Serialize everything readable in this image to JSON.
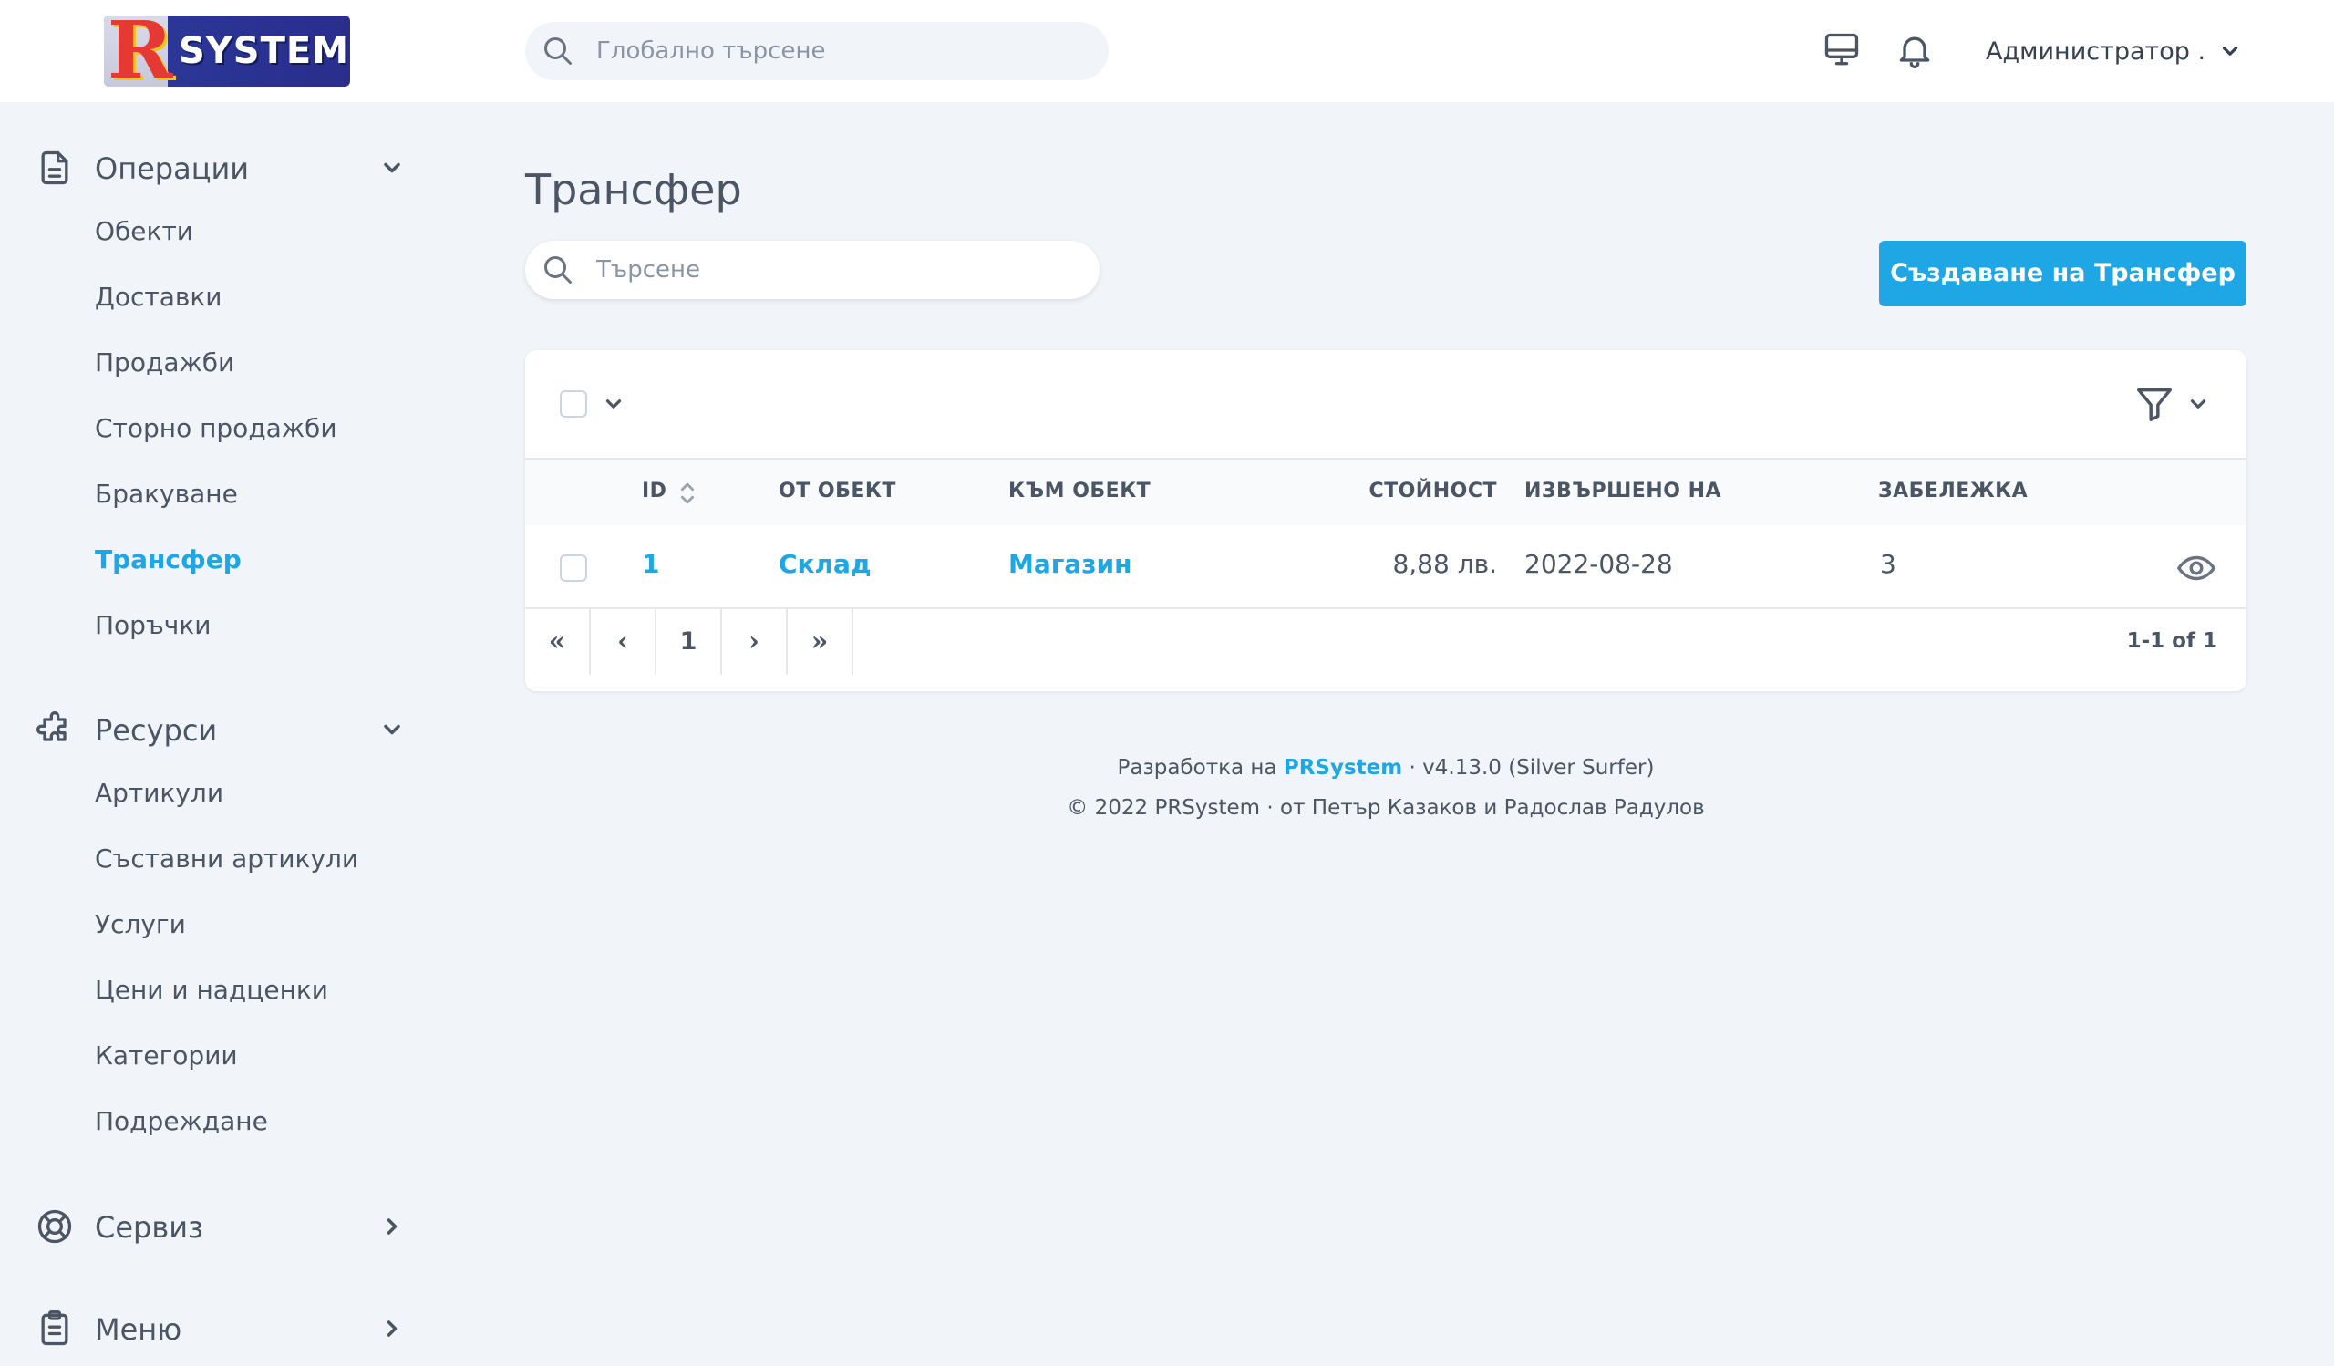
{
  "header": {
    "logo_text": "SYSTEM",
    "logo_letter": "R",
    "global_search_placeholder": "Глобално търсене",
    "user_label": "Администратор ."
  },
  "sidebar": {
    "operations": {
      "label": "Операции",
      "items": [
        "Обекти",
        "Доставки",
        "Продажби",
        "Сторно продажби",
        "Бракуване",
        "Трансфер",
        "Поръчки"
      ],
      "active": "Трансфер"
    },
    "resources": {
      "label": "Ресурси",
      "items": [
        "Артикули",
        "Съставни артикули",
        "Услуги",
        "Цени и надценки",
        "Категории",
        "Подреждане"
      ]
    },
    "service": {
      "label": "Сервиз"
    },
    "menu": {
      "label": "Меню"
    }
  },
  "main": {
    "title": "Трансфер",
    "search_placeholder": "Търсене",
    "create_button": "Създаване на Трансфер",
    "table": {
      "columns": [
        "ID",
        "ОТ ОБЕКТ",
        "КЪМ ОБЕКТ",
        "СТОЙНОСТ",
        "ИЗВЪРШЕНО НА",
        "ЗАБЕЛЕЖКА"
      ],
      "rows": [
        {
          "id": "1",
          "from": "Склад",
          "to": "Магазин",
          "value": "8,88 лв.",
          "date": "2022-08-28",
          "note": "3"
        }
      ]
    },
    "pagination": {
      "first": "«",
      "prev": "‹",
      "page": "1",
      "next": "›",
      "last": "»",
      "info": "1-1 of 1"
    }
  },
  "footer": {
    "line1_prefix": "Разработка на",
    "line1_brand": "PRSystem",
    "line1_suffix": "· v4.13.0 (Silver Surfer)",
    "line2": "© 2022 PRSystem · от Петър Казаков и Радослав Радулов"
  },
  "colors": {
    "accent": "#1ea7e4",
    "background": "#f1f5f9",
    "text": "#4b5563"
  }
}
